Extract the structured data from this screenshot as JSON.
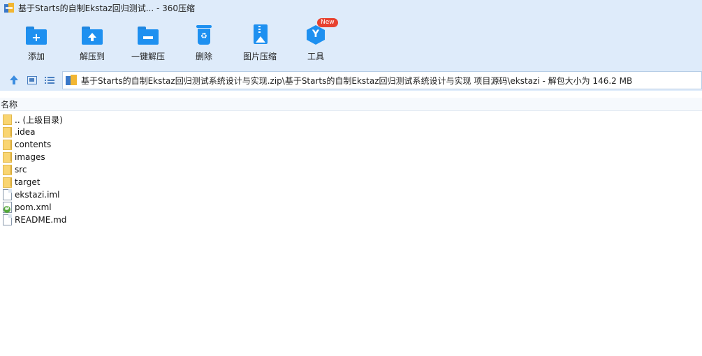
{
  "window": {
    "title": "基于Starts的自制Ekstaz回归测试... - 360压缩"
  },
  "toolbar": {
    "items": [
      {
        "label": "添加",
        "icon": "add-folder-icon"
      },
      {
        "label": "解压到",
        "icon": "extract-to-icon"
      },
      {
        "label": "一键解压",
        "icon": "one-click-extract-icon"
      },
      {
        "label": "删除",
        "icon": "recycle-bin-icon"
      },
      {
        "label": "图片压缩",
        "icon": "image-compress-icon"
      },
      {
        "label": "工具",
        "icon": "tools-icon"
      }
    ],
    "new_badge": "New"
  },
  "address": {
    "path": "基于Starts的自制Ekstaz回归测试系统设计与实现.zip\\基于Starts的自制Ekstaz回归测试系统设计与实现 项目源码\\ekstazi - 解包大小为 146.2 MB"
  },
  "list": {
    "column_name": "名称",
    "items": [
      {
        "name": ".. (上级目录)",
        "type": "folder"
      },
      {
        "name": ".idea",
        "type": "folder"
      },
      {
        "name": "contents",
        "type": "folder"
      },
      {
        "name": "images",
        "type": "folder"
      },
      {
        "name": "src",
        "type": "folder"
      },
      {
        "name": "target",
        "type": "folder"
      },
      {
        "name": "ekstazi.iml",
        "type": "file"
      },
      {
        "name": "pom.xml",
        "type": "xml"
      },
      {
        "name": "README.md",
        "type": "file"
      }
    ]
  },
  "colors": {
    "toolbar_bg": "#deebfa",
    "accent": "#1e90f0",
    "folder": "#f9d572",
    "badge": "#e8412f"
  }
}
